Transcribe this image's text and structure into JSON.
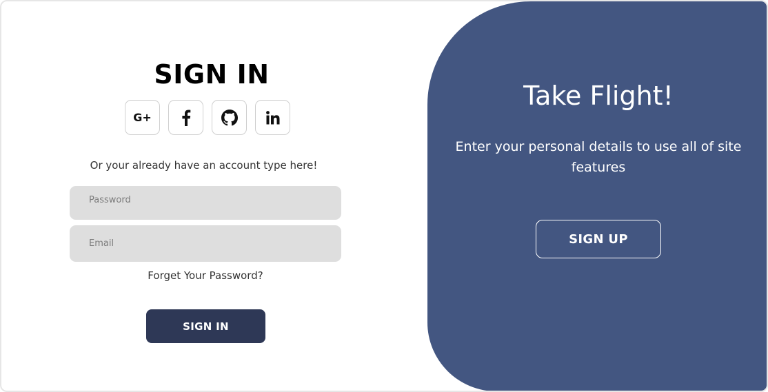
{
  "signin": {
    "title": "SIGN IN",
    "alt_text": "Or your already have an account type here!",
    "password_placeholder": "Password",
    "email_placeholder": "Email",
    "forgot_label": "Forget Your Password?",
    "submit_label": "SIGN IN",
    "socials": [
      {
        "name": "google-plus",
        "icon": "google-plus-icon",
        "text": "G+"
      },
      {
        "name": "facebook",
        "icon": "facebook-icon"
      },
      {
        "name": "github",
        "icon": "github-icon"
      },
      {
        "name": "linkedin",
        "icon": "linkedin-icon"
      }
    ]
  },
  "toggle_panel": {
    "title": "Take Flight!",
    "text": "Enter your personal details to use all of site features",
    "signup_label": "SIGN UP"
  },
  "colors": {
    "panel_bg": "#435681",
    "primary_button": "#2e3856",
    "input_bg": "#dedede",
    "text": "#333333"
  }
}
